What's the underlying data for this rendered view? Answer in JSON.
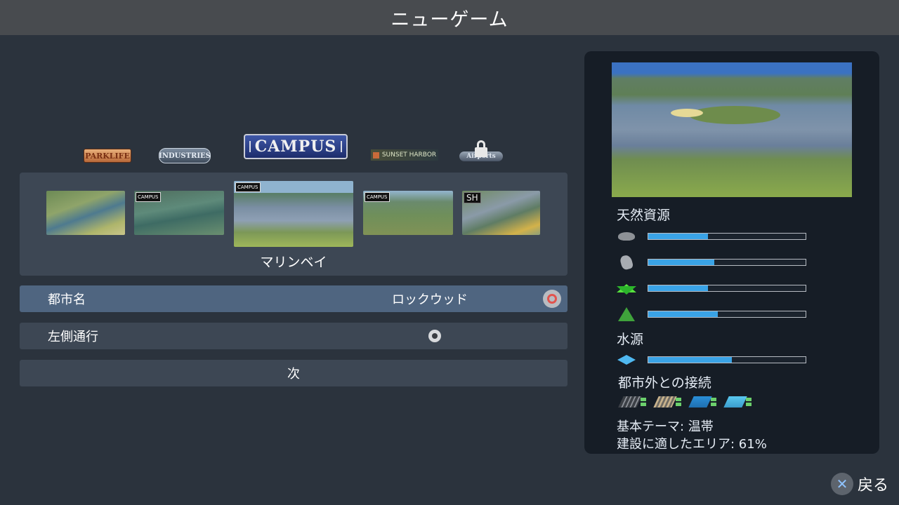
{
  "header": {
    "title": "ニューゲーム"
  },
  "expansions": {
    "parklife": "PARKLIFE",
    "industries": "INDUSTRIES",
    "campus": "CAMPUS",
    "sunset_harbor": "SUNSET HARBOR",
    "airports": "Airports"
  },
  "maps": {
    "thumbnails": [
      {
        "badge": ""
      },
      {
        "badge": "CAMPUS"
      },
      {
        "badge": "CAMPUS"
      },
      {
        "badge": "CAMPUS"
      },
      {
        "badge": "SH"
      }
    ],
    "selected_name": "マリンベイ"
  },
  "form": {
    "city_name_label": "都市名",
    "city_name_value": "ロックウッド",
    "left_traffic_label": "左側通行",
    "next_label": "次"
  },
  "info": {
    "natural_resources_title": "天然資源",
    "resources": [
      {
        "icon": "oil-icon",
        "level": 0.38
      },
      {
        "icon": "ore-icon",
        "level": 0.42
      },
      {
        "icon": "fertile-land-icon",
        "level": 0.38
      },
      {
        "icon": "forest-icon",
        "level": 0.44
      }
    ],
    "water_title": "水源",
    "water": {
      "icon": "water-icon",
      "level": 0.53
    },
    "connections_title": "都市外との接続",
    "connections": [
      "highway-connection-icon",
      "train-connection-icon",
      "ship-connection-icon",
      "airplane-connection-icon"
    ],
    "theme_text": "基本テーマ: 温帯",
    "buildable_text": "建設に適したエリア: 61%"
  },
  "footer": {
    "back_label": "戻る",
    "back_icon": "cross-button-icon"
  }
}
